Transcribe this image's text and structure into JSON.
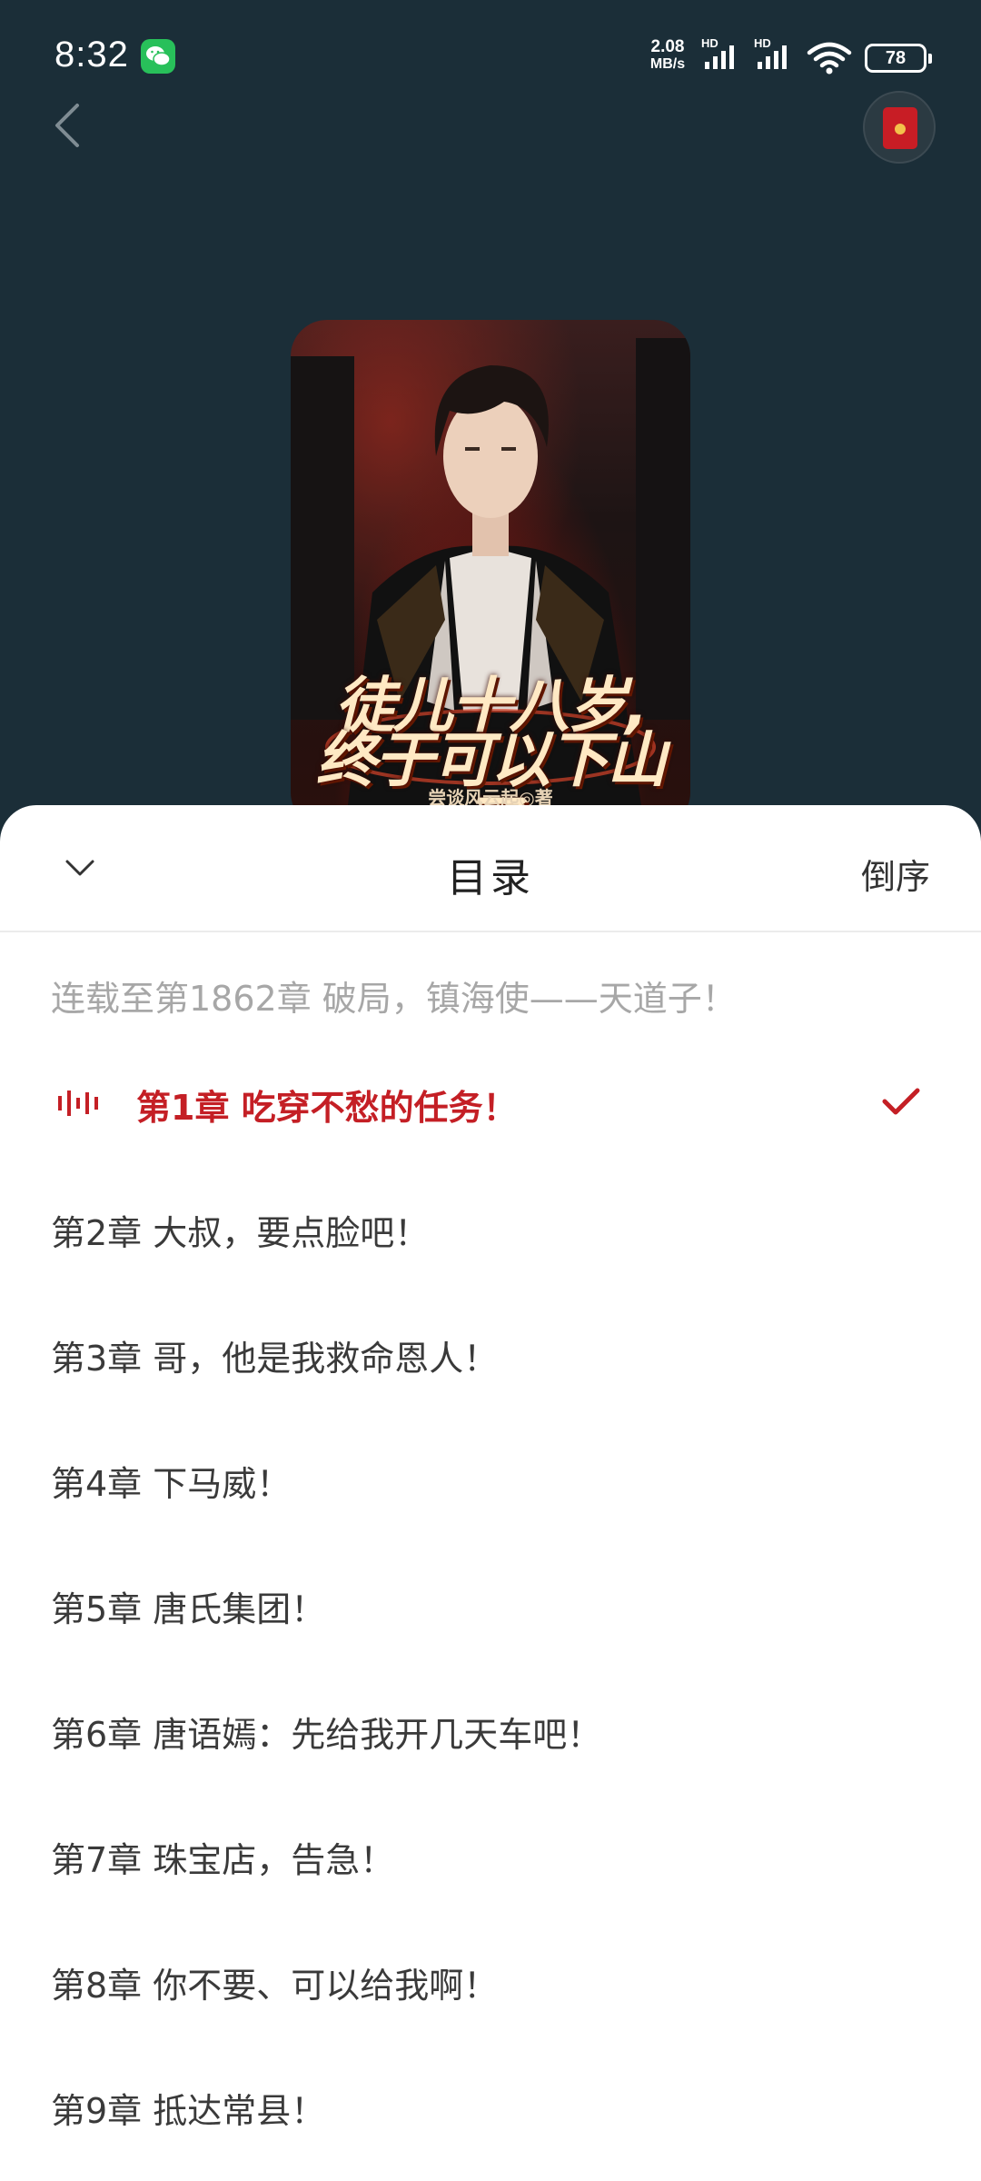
{
  "status_bar": {
    "time": "8:32",
    "network_speed_value": "2.08",
    "network_speed_unit": "MB/s",
    "signal_1_label": "HD",
    "signal_2_label": "HD",
    "battery": "78",
    "icons": [
      "wechat-icon",
      "signal-icon",
      "signal-icon",
      "wifi-icon",
      "battery-icon"
    ]
  },
  "top_bar": {
    "icons": [
      "back-arrow-icon",
      "red-packet-icon"
    ]
  },
  "book": {
    "cover_title_line1": "徒儿十八岁,",
    "cover_title_line2": "终于可以下山了",
    "cover_author": "尝谈风云起◎著"
  },
  "catalog": {
    "title": "目录",
    "sort_label": "倒序",
    "serial_info": "连载至第1862章  破局，镇海使——天道子！",
    "chapters": [
      {
        "label": "第1章  吃穿不愁的任务！",
        "current": true
      },
      {
        "label": "第2章  大叔，要点脸吧！"
      },
      {
        "label": "第3章  哥，他是我救命恩人！"
      },
      {
        "label": "第4章  下马威！"
      },
      {
        "label": "第5章  唐氏集团！"
      },
      {
        "label": "第6章  唐语嫣：先给我开几天车吧！"
      },
      {
        "label": "第7章  珠宝店，告急！"
      },
      {
        "label": "第8章  你不要、可以给我啊！"
      },
      {
        "label": "第9章  抵达常县！"
      }
    ]
  },
  "colors": {
    "background": "#1b2e38",
    "accent_red": "#c41f25",
    "sheet": "#ffffff",
    "muted_text": "#a7a7a7"
  }
}
